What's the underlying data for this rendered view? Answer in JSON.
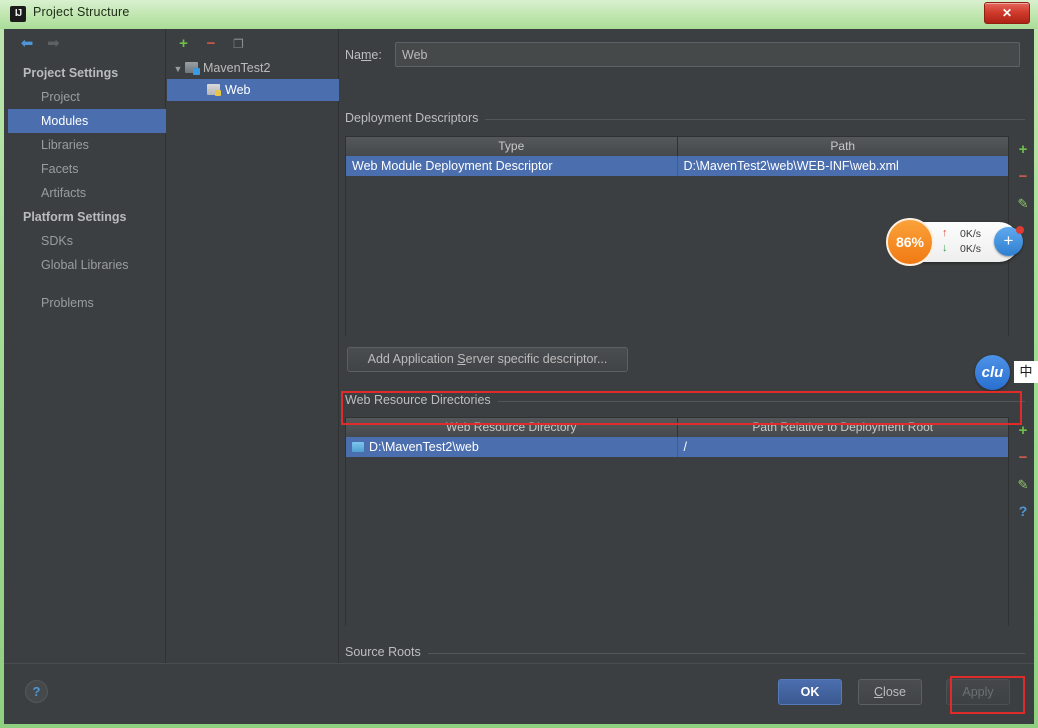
{
  "window": {
    "title": "Project Structure",
    "logo_text": "IJ",
    "close_label": "✕"
  },
  "sidebar": {
    "nav_back": "⬅",
    "nav_forward": "➡",
    "entries": [
      {
        "label": "Project Settings",
        "type": "group"
      },
      {
        "label": "Project",
        "type": "item"
      },
      {
        "label": "Modules",
        "type": "item",
        "selected": true
      },
      {
        "label": "Libraries",
        "type": "item"
      },
      {
        "label": "Facets",
        "type": "item"
      },
      {
        "label": "Artifacts",
        "type": "item"
      },
      {
        "label": "Platform Settings",
        "type": "group"
      },
      {
        "label": "SDKs",
        "type": "item"
      },
      {
        "label": "Global Libraries",
        "type": "item"
      },
      {
        "label": "",
        "type": "sep"
      },
      {
        "label": "Problems",
        "type": "item"
      }
    ]
  },
  "tree_panel": {
    "toolbar": {
      "add": "+",
      "remove": "−",
      "copy": "❐"
    },
    "nodes": [
      {
        "label": "MavenTest2",
        "twisty": "▼",
        "depth": 0,
        "selected": false
      },
      {
        "label": "Web",
        "twisty": "",
        "depth": 1,
        "selected": true
      }
    ]
  },
  "main": {
    "name_label_pre": "Na",
    "name_label_accel": "m",
    "name_label_post": "e:",
    "name_value": "Web",
    "name_placeholder": "",
    "deployment": {
      "section_title": "Deployment Descriptors",
      "columns": [
        "Type",
        "Path"
      ],
      "rows": [
        [
          "Web Module Deployment Descriptor",
          "D:\\MavenTest2\\web\\WEB-INF\\web.xml"
        ]
      ],
      "toolbar": {
        "add": "+",
        "remove": "−",
        "edit": "✎"
      }
    },
    "add_descriptor": {
      "pre": "Add Application ",
      "accel": "S",
      "post": "erver specific descriptor..."
    },
    "web_resources": {
      "section_title": "Web Resource Directories",
      "columns": [
        "Web Resource Directory",
        "Path Relative to Deployment Root"
      ],
      "rows": [
        [
          "D:\\MavenTest2\\web",
          "/"
        ]
      ],
      "toolbar": {
        "add": "+",
        "remove": "−",
        "edit": "✎",
        "help": "?"
      }
    },
    "source_roots": {
      "section_title": "Source Roots",
      "rows": []
    }
  },
  "bottom": {
    "help": "?",
    "ok": "OK",
    "close_pre": "",
    "close_accel": "C",
    "close_post": "lose",
    "apply": "Apply"
  },
  "overlays": {
    "network_widget": {
      "percent": "86%",
      "up_value": "0K/s",
      "down_value": "0K/s",
      "up_arrow": "↑",
      "down_arrow": "↓",
      "plus": "+"
    },
    "clu_badge": "clu",
    "ime_badge": "中"
  },
  "colors": {
    "accent_selection": "#4b6eaf",
    "panel_bg": "#3c3f41",
    "annotation_red": "#e02b2b",
    "titlebar_green": "#a9dc98",
    "orange_gauge": "#f07a14"
  }
}
